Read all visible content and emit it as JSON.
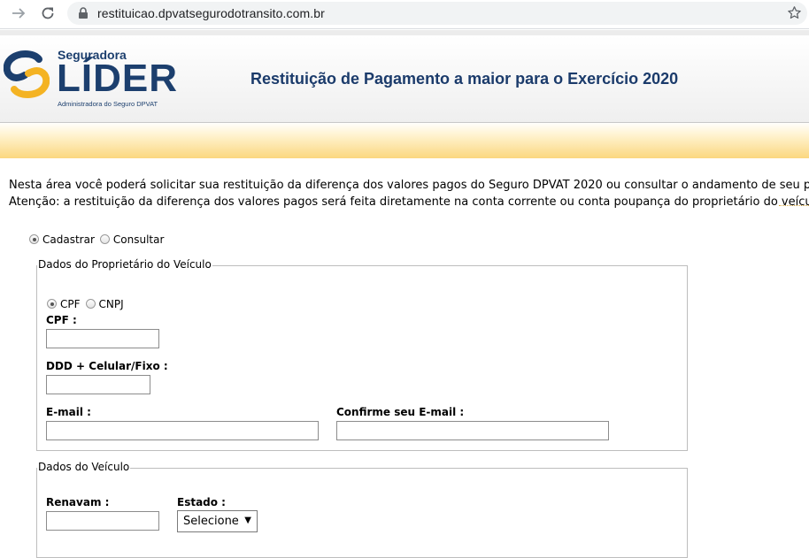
{
  "browser": {
    "url": "restituicao.dpvatsegurodotransito.com.br"
  },
  "brand": {
    "small": "Seguradora",
    "main": "LÍDER",
    "sub": "Administradora do Seguro DPVAT",
    "colors": {
      "navy": "#1c3f6e",
      "yellow": "#f4b323"
    }
  },
  "header": {
    "title": "Restituição de Pagamento a maior para o Exercício 2020"
  },
  "intro": {
    "line1": "Nesta área você poderá solicitar sua restituição da diferença dos valores pagos do Seguro DPVAT 2020 ou consultar o andamento de seu pedido.",
    "line2": "Atenção: a restituição da diferença dos valores pagos será feita diretamente na conta corrente ou conta poupança do proprietário do veículo."
  },
  "mode": {
    "options": [
      "Cadastrar",
      "Consultar"
    ],
    "selected": "Cadastrar"
  },
  "owner": {
    "legend": "Dados do Proprietário do Veículo",
    "doc_types": [
      "CPF",
      "CNPJ"
    ],
    "doc_selected": "CPF",
    "cpf_label": "CPF :",
    "cpf_value": "",
    "phone_label": "DDD + Celular/Fixo :",
    "phone_value": "",
    "email_label": "E-mail :",
    "email_value": "",
    "email_confirm_label": "Confirme seu E-mail :",
    "email_confirm_value": ""
  },
  "vehicle": {
    "legend": "Dados do Veículo",
    "renavam_label": "Renavam :",
    "renavam_value": "",
    "state_label": "Estado :",
    "state_selected": "Selecione"
  }
}
